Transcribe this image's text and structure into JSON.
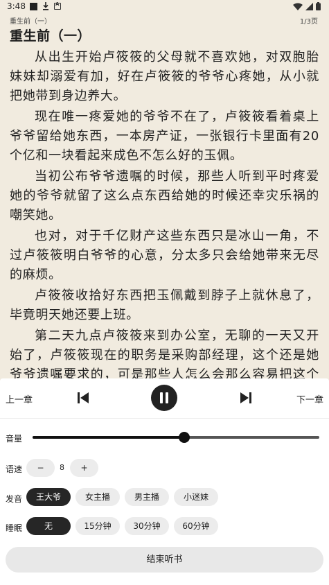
{
  "status_bar": {
    "time": "3:48"
  },
  "reader_header": {
    "chapter_small": "重生前（一）",
    "page_indicator": "1/3页"
  },
  "content": {
    "title": "重生前（一）",
    "paragraphs": [
      "从出生开始卢筱筱的父母就不喜欢她，对双胞胎妹妹却溺爱有加，好在卢筱筱的爷爷心疼她，从小就把她带到身边养大。",
      "现在唯一疼爱她的爷爷不在了，卢筱筱看着桌上爷爷留给她东西，一本房产证，一张银行卡里面有20个亿和一块看起来成色不怎么好的玉佩。",
      "当初公布爷爷遗嘱的时候，那些人听到平时疼爱她的爷爷就留了这么点东西给她的时候还幸灾乐祸的嘲笑她。",
      "也对，对于千亿财产这些东西只是冰山一角，不过卢筱筱明白爷爷的心意，分太多只会给她带来无尽的麻烦。",
      "卢筱筱收拾好东西把玉佩戴到脖子上就休息了，毕竟明天她还要上班。",
      "第二天九点卢筱筱来到办公室，无聊的一天又开始了，卢筱筱现在的职务是采购部经理，这个还是她爷爷遗嘱要求的，可是那些人怎么会那么容易把这个油水最多的部门给她呢？所以她现在就是一个挂名经理。"
    ]
  },
  "controls": {
    "prev_chapter": "上一章",
    "next_chapter": "下一章",
    "prev_icon": "skip-previous-icon",
    "pause_icon": "pause-icon",
    "next_icon": "skip-next-icon"
  },
  "volume": {
    "label": "音量",
    "level": 0.53
  },
  "speed": {
    "label": "语速",
    "minus": "−",
    "value": "8",
    "plus": "+"
  },
  "voice": {
    "label": "发音",
    "options": [
      "王大爷",
      "女主播",
      "男主播",
      "小迷妹"
    ],
    "selected": "王大爷"
  },
  "sleep": {
    "label": "睡眠",
    "options": [
      "无",
      "15分钟",
      "30分钟",
      "60分钟"
    ],
    "selected": "无"
  },
  "end_button": "结束听书",
  "colors": {
    "page_background": "#f1ebdf",
    "panel_background": "#ffffff",
    "accent_dark": "#262626",
    "pill_background": "#ececec"
  }
}
